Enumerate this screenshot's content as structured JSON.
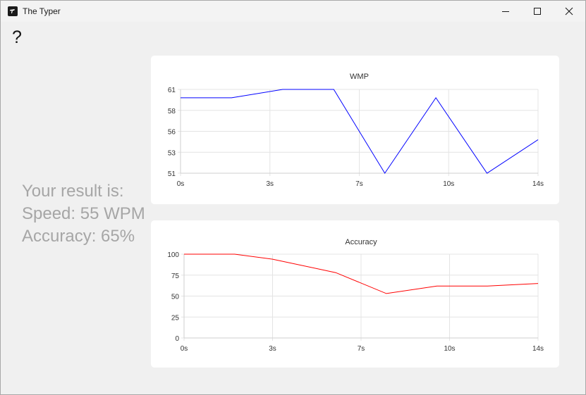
{
  "window": {
    "title": "The Typer"
  },
  "help_label": "?",
  "result": {
    "heading": "Your result is:",
    "speed": "Speed: 55 WPM",
    "accuracy": "Accuracy: 65%"
  },
  "chart_data": [
    {
      "type": "line",
      "title": "WMP",
      "xlabel": "",
      "ylabel": "",
      "x_ticks": [
        "0s",
        "3s",
        "7s",
        "10s",
        "14s"
      ],
      "y_ticks": [
        "51",
        "53",
        "56",
        "58",
        "61"
      ],
      "xlim": [
        0,
        14
      ],
      "ylim": [
        51,
        61
      ],
      "grid": true,
      "series": [
        {
          "color": "#0000ff",
          "x": [
            0,
            2,
            4,
            6,
            8,
            10,
            12,
            14
          ],
          "y": [
            60,
            60,
            61,
            61,
            51,
            60,
            51,
            55
          ]
        }
      ]
    },
    {
      "type": "line",
      "title": "Accuracy",
      "xlabel": "",
      "ylabel": "",
      "x_ticks": [
        "0s",
        "3s",
        "7s",
        "10s",
        "14s"
      ],
      "y_ticks": [
        "0",
        "25",
        "50",
        "75",
        "100"
      ],
      "xlim": [
        0,
        14
      ],
      "ylim": [
        0,
        100
      ],
      "grid": true,
      "series": [
        {
          "color": "#ff0000",
          "x": [
            0,
            2,
            3.5,
            6,
            8,
            10,
            12,
            14
          ],
          "y": [
            100,
            100,
            94,
            78,
            53,
            62,
            62,
            65
          ]
        }
      ]
    }
  ]
}
